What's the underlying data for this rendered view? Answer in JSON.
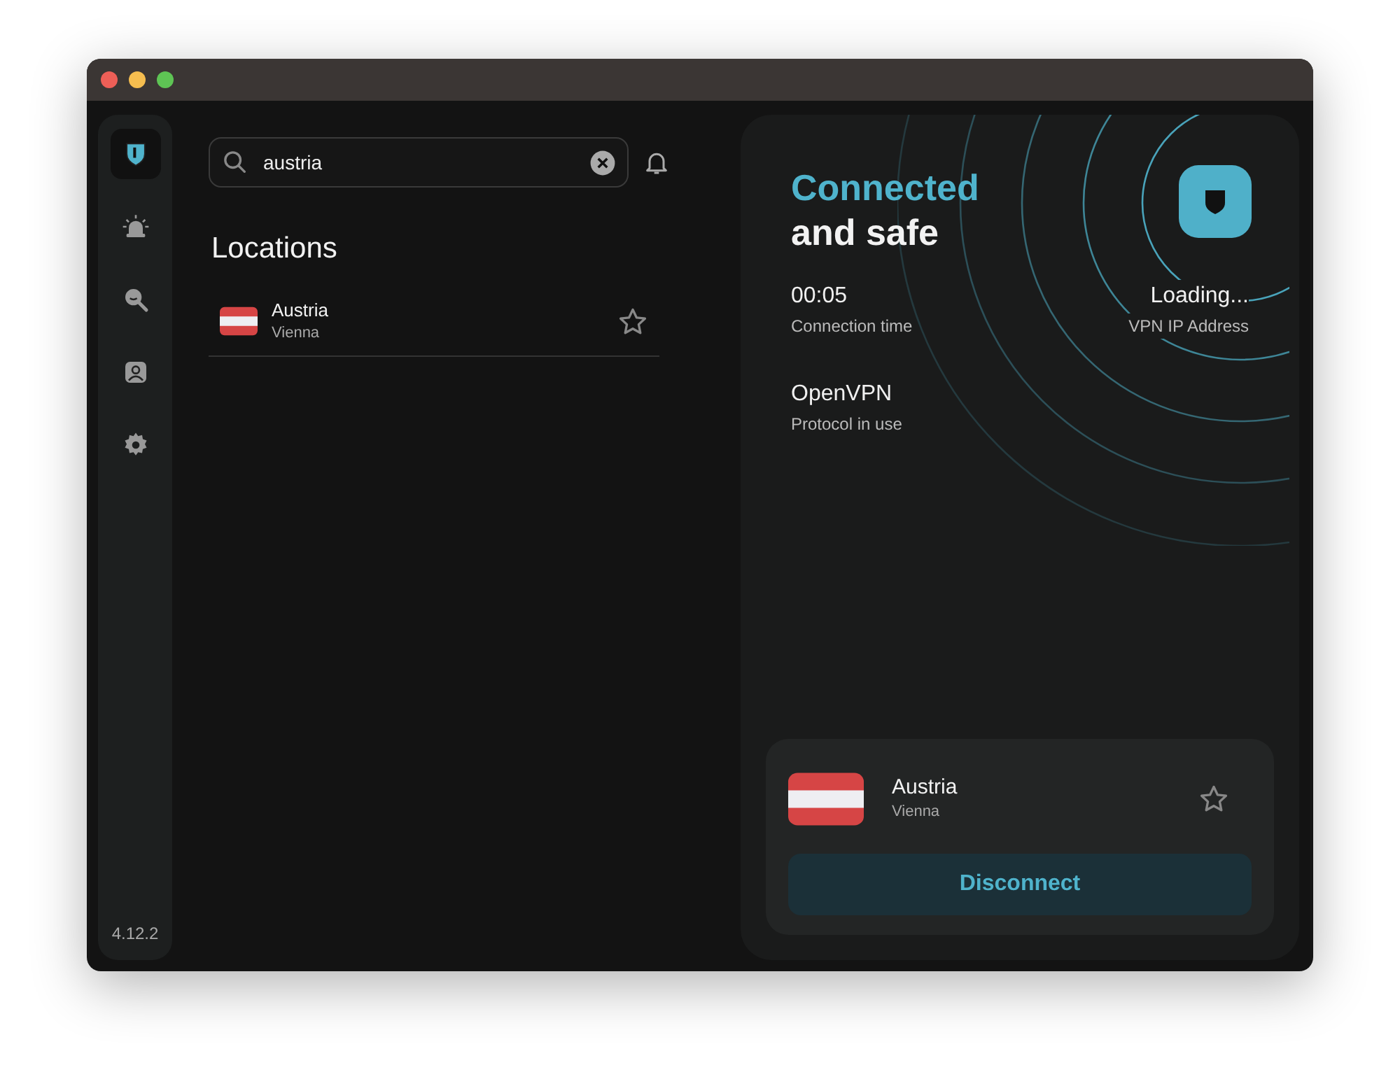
{
  "sidebar": {
    "items": [
      {
        "selected": true
      },
      {
        "selected": false
      },
      {
        "selected": false
      },
      {
        "selected": false
      },
      {
        "selected": false
      }
    ],
    "version": "4.12.2"
  },
  "search": {
    "value": "austria"
  },
  "locations": {
    "title": "Locations",
    "items": [
      {
        "country": "Austria",
        "city": "Vienna",
        "favorite": false
      }
    ]
  },
  "status": {
    "title": "Connected",
    "subtitle": "and safe",
    "stats": [
      {
        "value": "00:05",
        "label": "Connection time"
      },
      {
        "value": "Loading...",
        "label": "VPN IP Address"
      }
    ],
    "protocol": {
      "value": "OpenVPN",
      "label": "Protocol in use"
    }
  },
  "current": {
    "country": "Austria",
    "city": "Vienna",
    "favorite": false,
    "button": "Disconnect"
  }
}
